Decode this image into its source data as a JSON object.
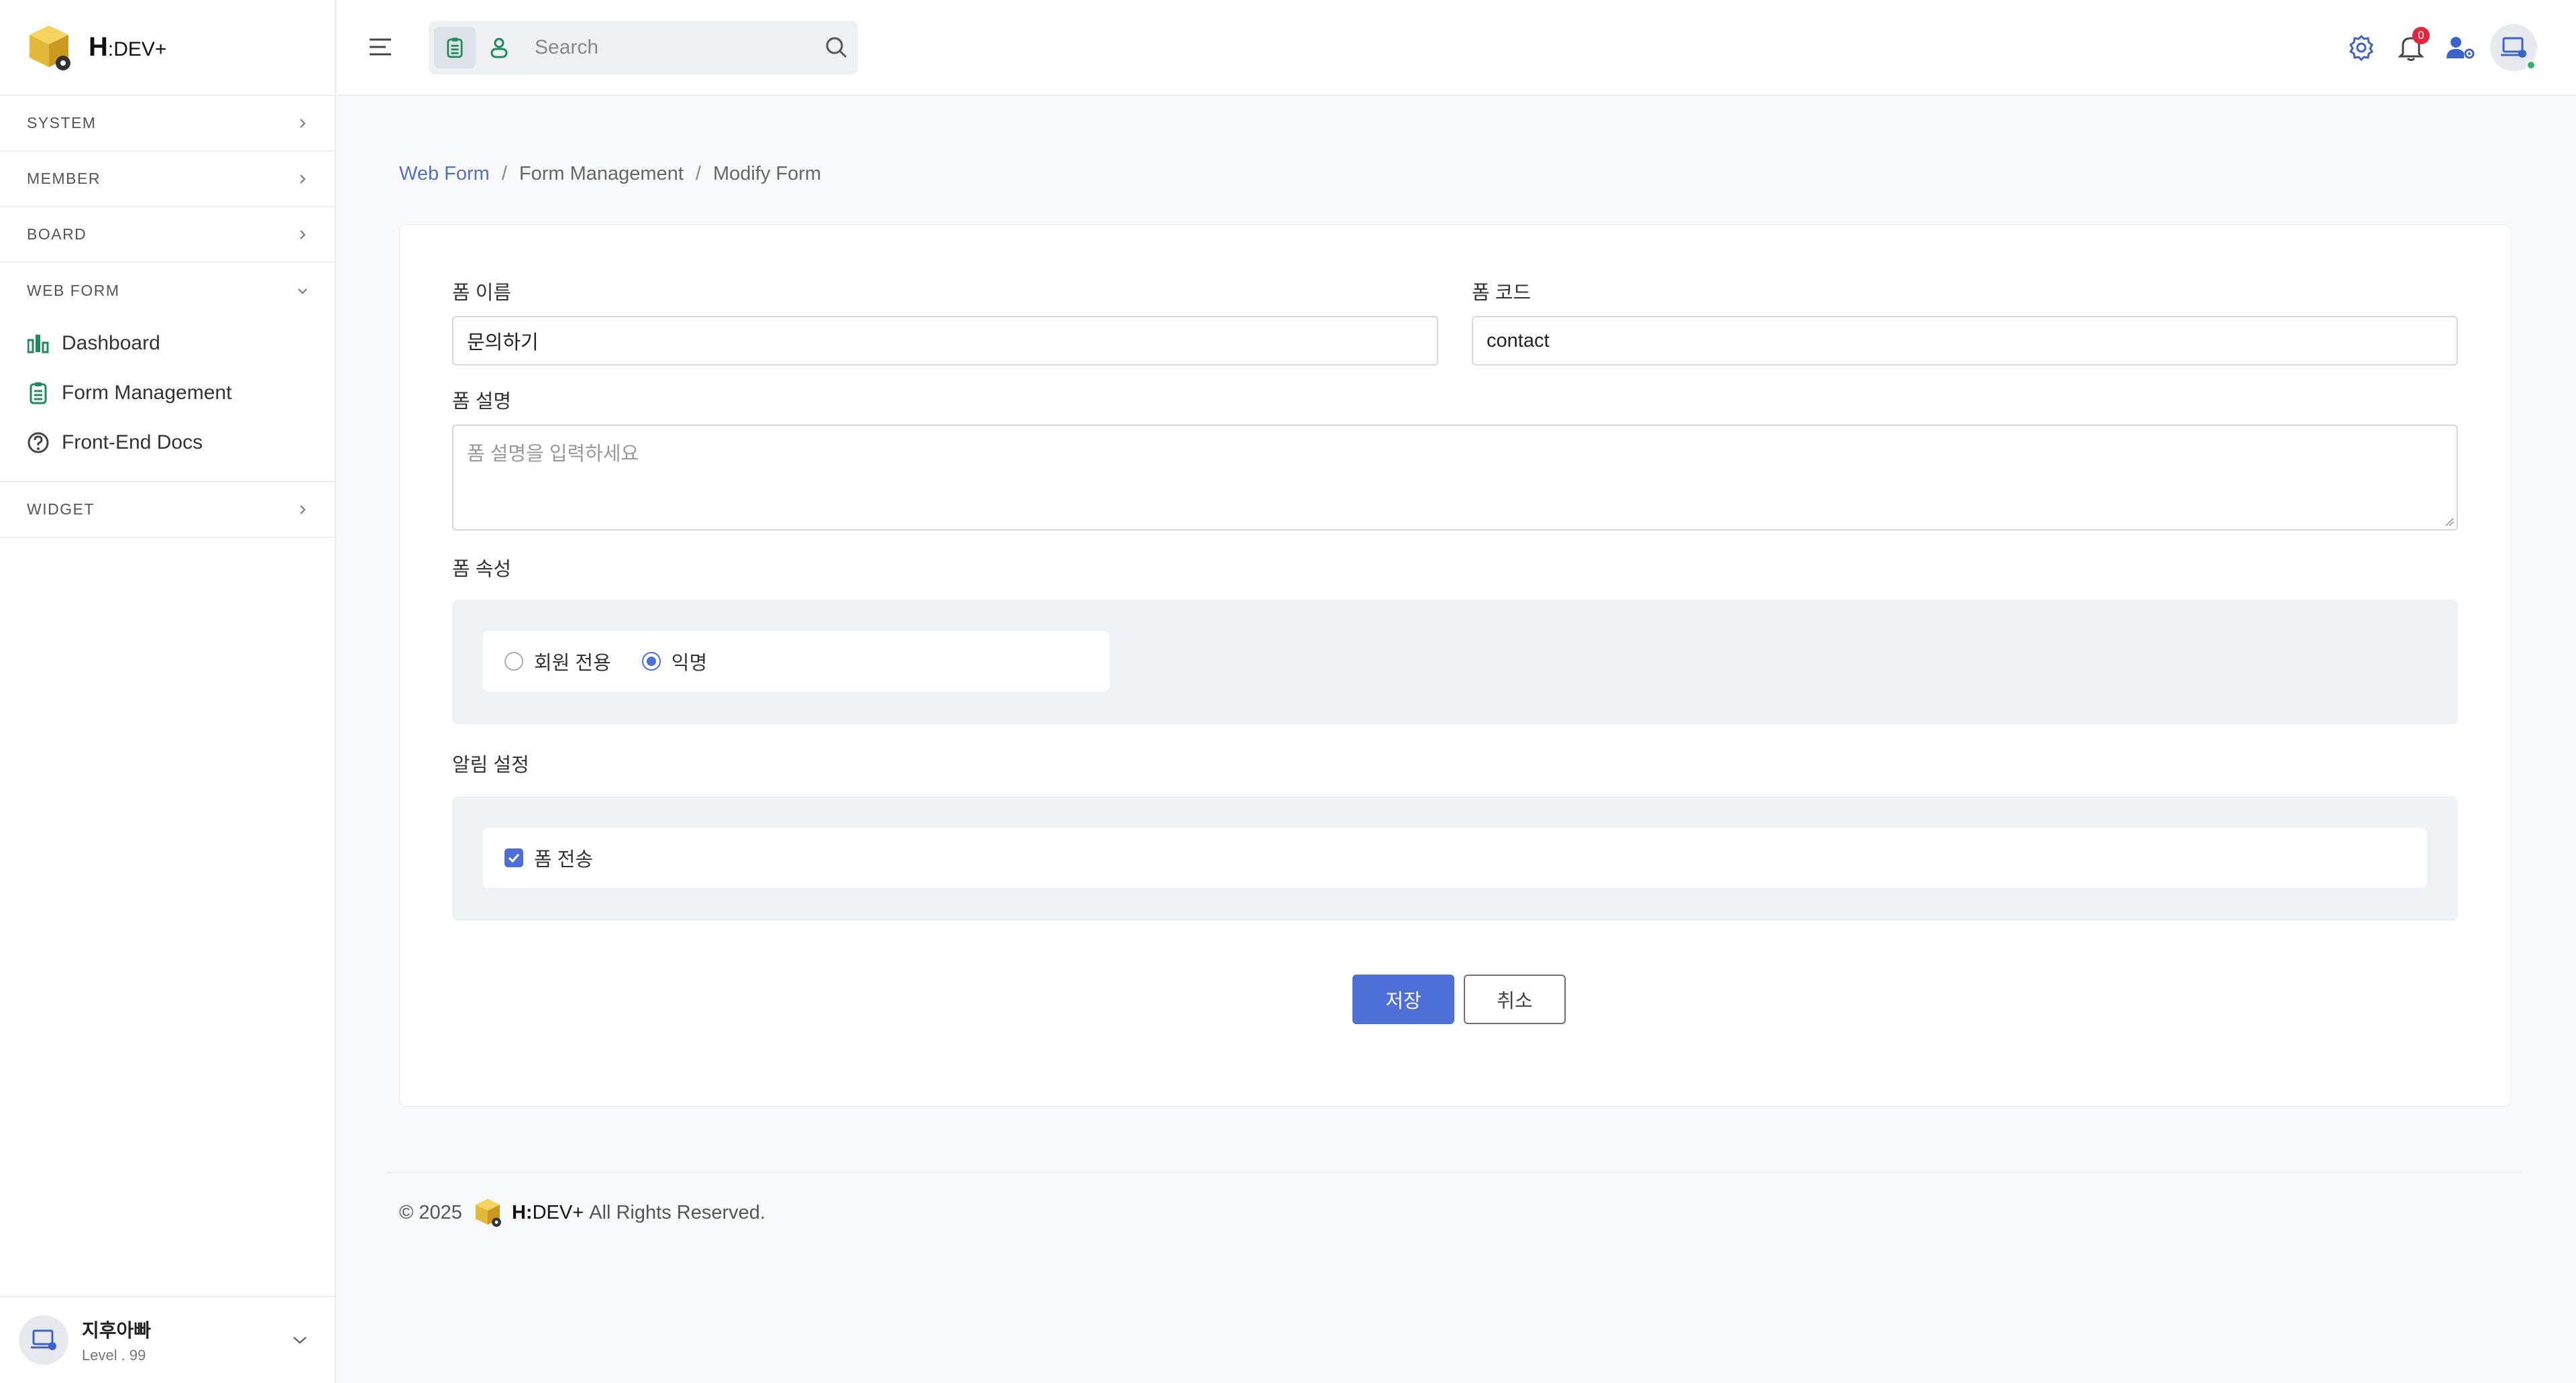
{
  "app": {
    "brand_h": "H",
    "brand_rest": ":DEV+"
  },
  "sidebar": {
    "sections": [
      {
        "label": "SYSTEM"
      },
      {
        "label": "MEMBER"
      },
      {
        "label": "BOARD"
      },
      {
        "label": "WEB FORM",
        "expanded": true
      },
      {
        "label": "WIDGET"
      }
    ],
    "webform_items": [
      {
        "label": "Dashboard",
        "icon": "bar-chart-icon"
      },
      {
        "label": "Form Management",
        "icon": "clipboard-icon",
        "active": true
      },
      {
        "label": "Front-End Docs",
        "icon": "question-circle-icon"
      }
    ],
    "user": {
      "name": "지후아빠",
      "level": "Level . 99"
    }
  },
  "header": {
    "search_placeholder": "Search",
    "notifications_count": "0",
    "icons": [
      "settings-icon",
      "bell-icon",
      "user-settings-icon",
      "profile-avatar"
    ]
  },
  "breadcrumb": {
    "items": [
      "Web Form",
      "Form Management",
      "Modify Form"
    ]
  },
  "form": {
    "name_label": "폼 이름",
    "name_value": "문의하기",
    "code_label": "폼 코드",
    "code_value": "contact",
    "desc_label": "폼 설명",
    "desc_placeholder": "폼 설명을 입력하세요",
    "attr_label": "폼 속성",
    "attr_options": [
      {
        "label": "회원 전용",
        "selected": false
      },
      {
        "label": "익명",
        "selected": true
      }
    ],
    "notify_label": "알림 설정",
    "notify_options": [
      {
        "label": "폼 전송",
        "checked": true
      }
    ],
    "save_label": "저장",
    "cancel_label": "취소"
  },
  "footer": {
    "copyright": "© 2025",
    "brand_h": "H:",
    "brand_rest": "DEV+",
    "rights": "All Rights Reserved."
  },
  "colors": {
    "accent": "#4e6fd6",
    "link": "#5370c4",
    "badge": "#e0273d",
    "icon_green": "#1f8a5b",
    "icon_blue": "#3d63c9"
  }
}
